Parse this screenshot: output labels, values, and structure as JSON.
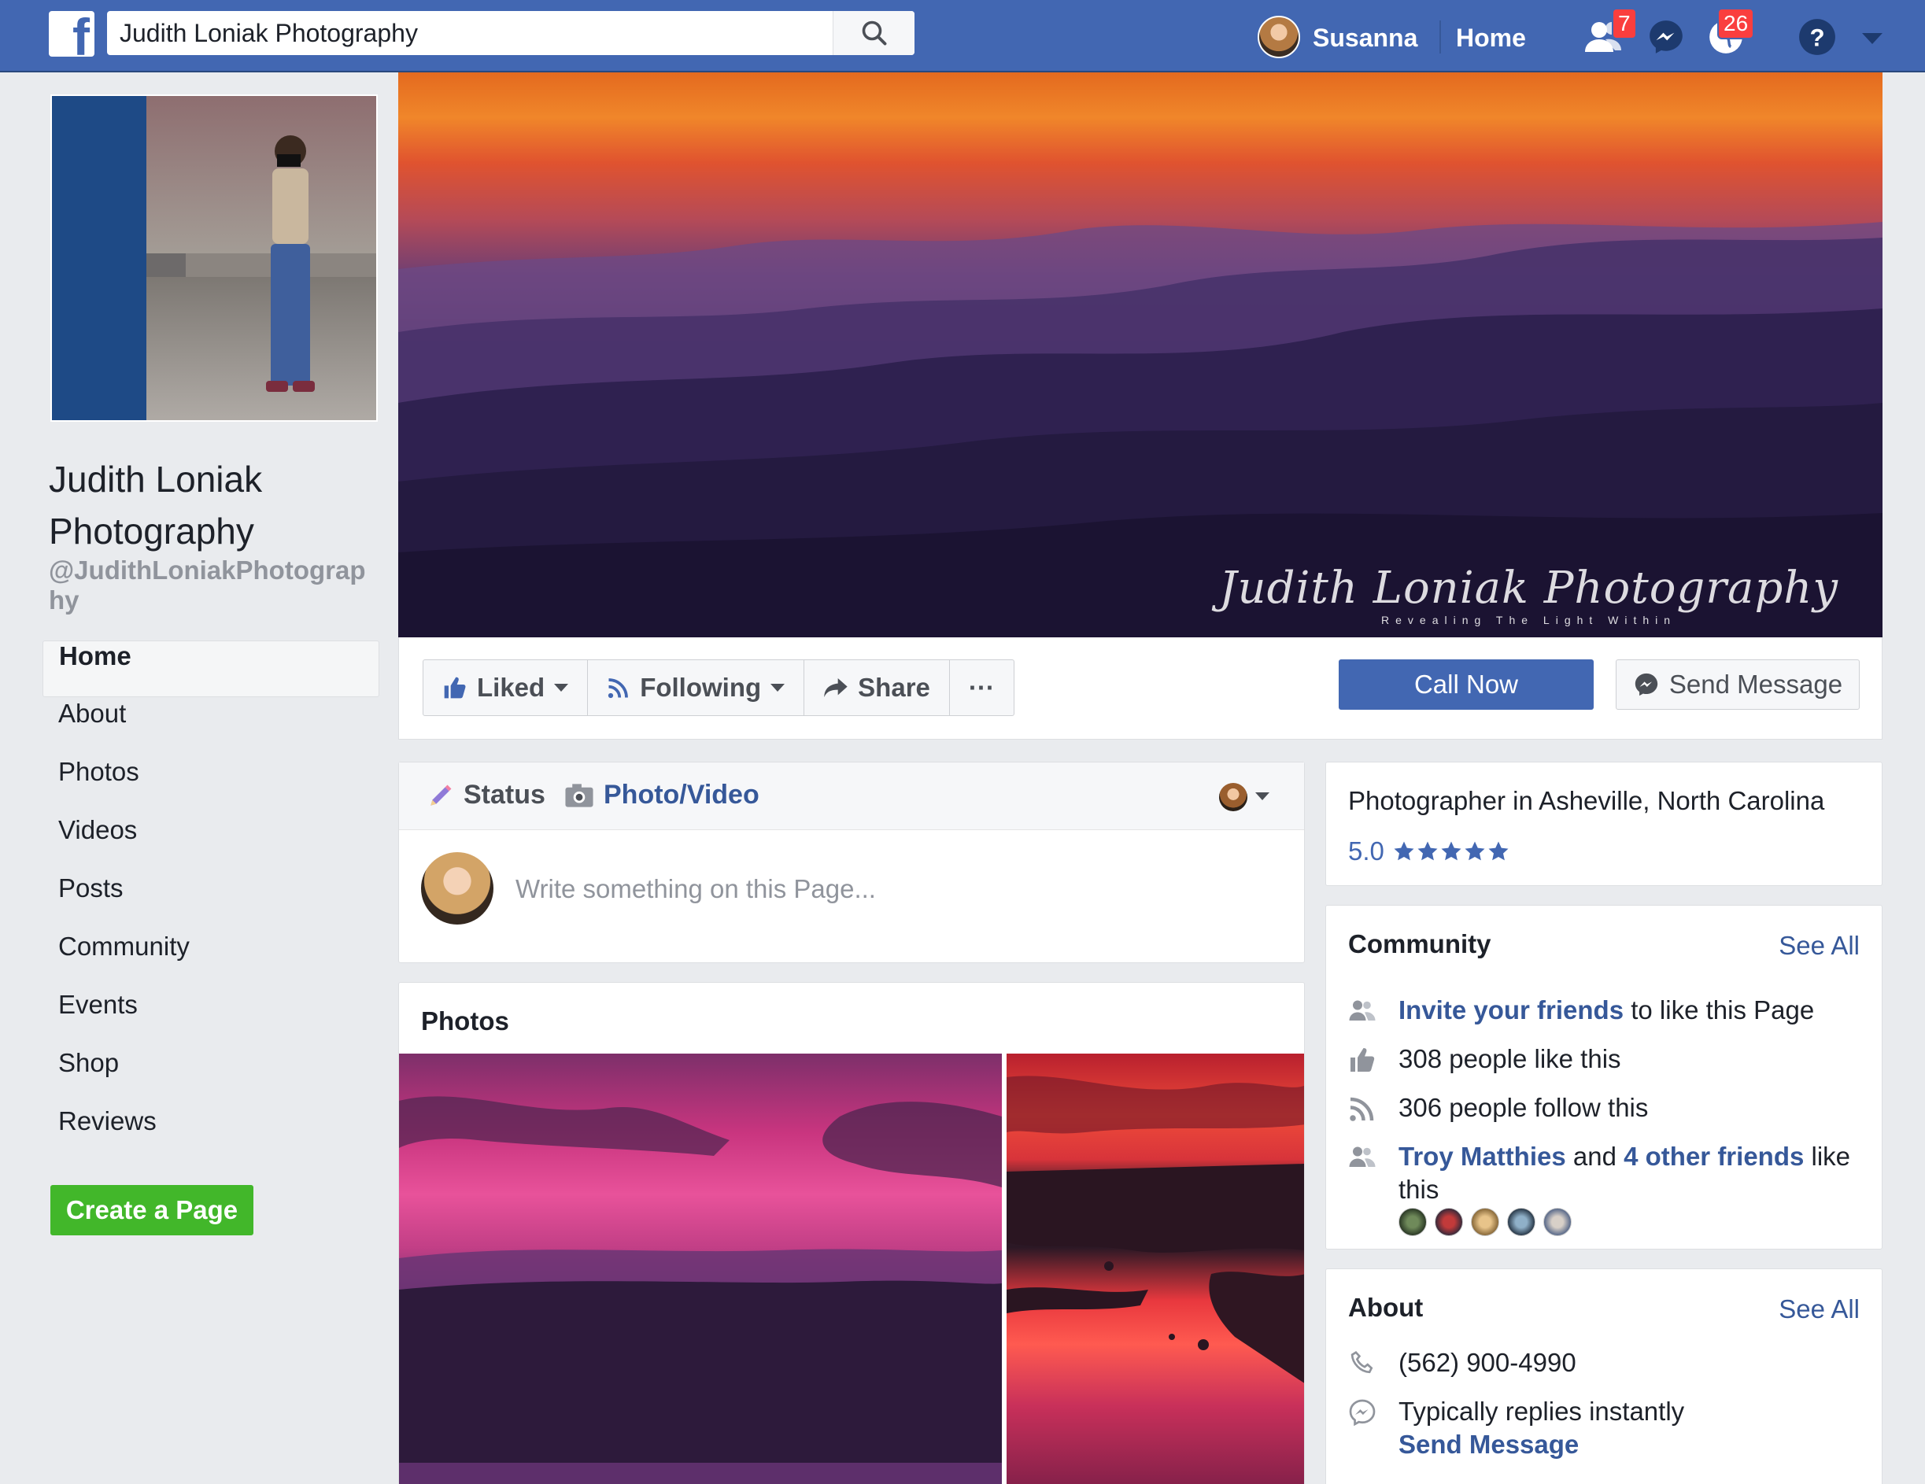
{
  "topbar": {
    "logo_letter": "f",
    "search_value": "Judith Loniak Photography",
    "user_name": "Susanna",
    "home_label": "Home",
    "friend_requests_count": "7",
    "notifications_count": "26"
  },
  "page": {
    "name": "Judith Loniak Photography",
    "handle": "@JudithLoniakPhotography"
  },
  "left_nav": {
    "items": [
      "Home",
      "About",
      "Photos",
      "Videos",
      "Posts",
      "Community",
      "Events",
      "Shop",
      "Reviews"
    ],
    "create_page_label": "Create a Page"
  },
  "cover": {
    "signature": "Judith Loniak Photography",
    "tagline": "Revealing The Light Within"
  },
  "actions": {
    "liked_label": "Liked",
    "following_label": "Following",
    "share_label": "Share",
    "more_label": "···",
    "call_now_label": "Call Now",
    "send_message_label": "Send Message"
  },
  "composer": {
    "status_label": "Status",
    "photo_video_label": "Photo/Video",
    "placeholder": "Write something on this Page..."
  },
  "photos": {
    "title": "Photos"
  },
  "info": {
    "category": "Photographer in Asheville, North Carolina",
    "rating": "5.0",
    "stars": 5
  },
  "community": {
    "title": "Community",
    "see_all": "See All",
    "invite_link": "Invite your friends",
    "invite_rest": " to like this Page",
    "likes": "308 people like this",
    "follows": "306 people follow this",
    "friend_name": "Troy Matthies",
    "friends_and": " and ",
    "other_friends": "4 other friends",
    "friends_rest": " like this"
  },
  "about": {
    "title": "About",
    "see_all": "See All",
    "phone": "(562) 900-4990",
    "replies": "Typically replies instantly",
    "send_message": "Send Message"
  },
  "colors": {
    "brand": "#4267b2",
    "link": "#365899",
    "green": "#42b72a",
    "badge": "#fa3e3e",
    "background": "#e9ebee"
  }
}
